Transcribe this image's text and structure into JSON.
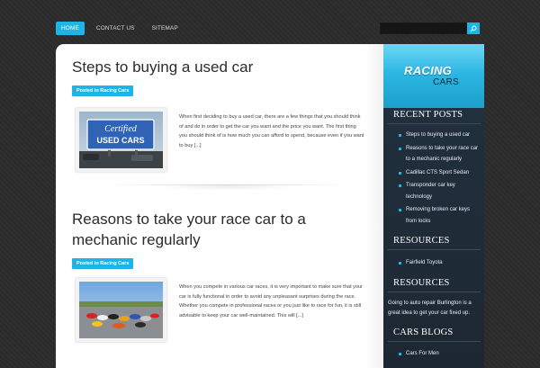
{
  "nav": {
    "items": [
      {
        "label": "HOME",
        "active": true
      },
      {
        "label": "CONTACT US",
        "active": false
      },
      {
        "label": "SITEMAP",
        "active": false
      }
    ]
  },
  "search": {
    "value": "",
    "placeholder": "",
    "icon": "search-icon"
  },
  "posts": [
    {
      "title": "Steps to buying a used car",
      "category": "Posted in Racing Cars",
      "excerpt": "When first deciding to buy a used car, there are a few things that you should think of and do in order to get the car you want and the price you want. The first thing you should think of is how much you can afford to spend, because even if you want to buy [...]",
      "thumbnail": {
        "sign_script": "Certified",
        "sign_text": "USED CARS"
      }
    },
    {
      "title": "Reasons to take your race car to a mechanic regularly",
      "category": "Posted in Racing Cars",
      "excerpt": "When you compete in various car races, it is very important to make sure that your car is fully functional in order to avoid any unpleasant surprises during the race. Whether you compete in professional races or you just like to race for fun, it is still advisable to keep your car well-maintained. This will [...]"
    }
  ],
  "sidebar": {
    "logo": {
      "main": "RACING",
      "sub": "CARS"
    },
    "recent_posts": {
      "title": "RECENT POSTS",
      "items": [
        "Steps to buying a used car",
        "Reasons to take your race car to a mechanic regularly",
        "Cadillac CTS Sport Sedan",
        "Transponder car key technology",
        "Removing broken car keys from locks"
      ]
    },
    "resources1": {
      "title": "RESOURCES",
      "items": [
        "Fairfield Toyota"
      ]
    },
    "resources2": {
      "title": "RESOURCES",
      "text": "Going to auto repair Burlington is a great idea to get your car fixed up."
    },
    "cars_blogs": {
      "title": "CARS BLOGS",
      "items": [
        "Cars For Men"
      ]
    }
  },
  "colors": {
    "accent": "#1cb6e6",
    "background": "#2c2c2c",
    "sidebar": "#1e2a35"
  }
}
